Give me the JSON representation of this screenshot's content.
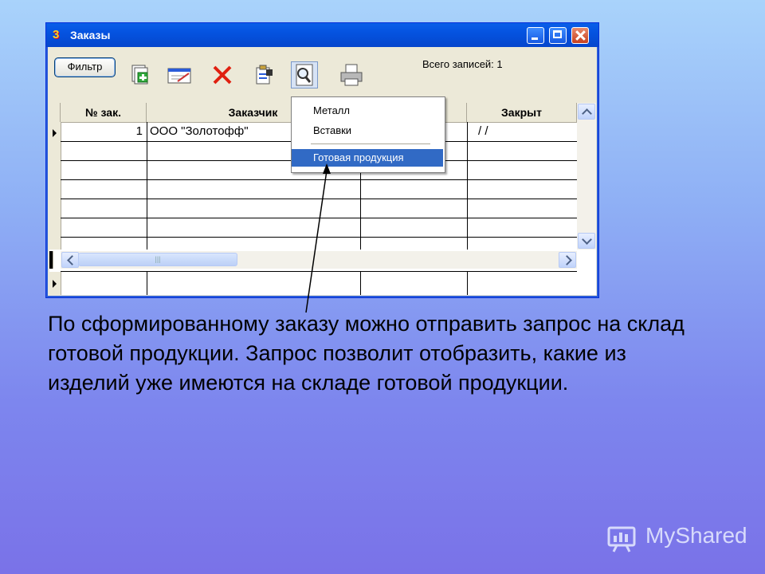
{
  "window": {
    "title": "Заказы"
  },
  "toolbar": {
    "filter_label": "Фильтр",
    "record_count": "Всего записей: 1"
  },
  "table": {
    "columns": [
      "№ зак.",
      "Заказчик",
      "",
      "Закрыт"
    ],
    "rows": [
      {
        "num": "1",
        "customer": "ООО \"Золотофф\"",
        "col3": "",
        "closed": "/ /"
      }
    ]
  },
  "dropdown": {
    "items": [
      "Металл",
      "Вставки",
      "Готовая продукция"
    ],
    "selected": "Готовая продукция"
  },
  "description": "По сформированному заказу можно отправить запрос на склад готовой продукции. Запрос позволит отобразить, какие из изделий уже имеются на складе готовой продукции.",
  "watermark": "MyShared",
  "colors": {
    "titlebar": "#0553e0",
    "selection": "#316ac5",
    "background_top": "#a9d3fb",
    "background_bottom": "#7a72e8"
  }
}
